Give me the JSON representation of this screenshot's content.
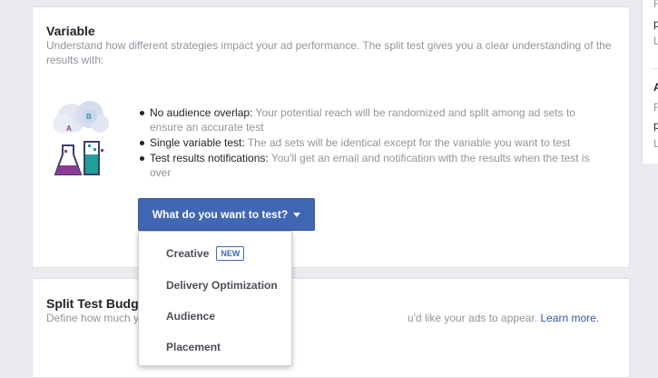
{
  "variable_card": {
    "title": "Variable",
    "description": "Understand how different strategies impact your ad performance. The split test gives you a clear understanding of the results with:",
    "bullets": [
      {
        "lead": "No audience overlap:",
        "text": " Your potential reach will be randomized and split among ad sets to ensure an accurate test"
      },
      {
        "lead": "Single variable test:",
        "text": " The ad sets will be identical except for the variable you want to test"
      },
      {
        "lead": "Test results notifications:",
        "text": " You'll get an email and notification with the results when the test is over"
      }
    ],
    "illustration_labels": {
      "a": "A",
      "b": "B"
    },
    "dropdown_label": "What do you want to test?"
  },
  "dropdown_menu": {
    "items": [
      {
        "label": "Creative",
        "badge": "NEW"
      },
      {
        "label": "Delivery Optimization"
      },
      {
        "label": "Audience"
      },
      {
        "label": "Placement"
      }
    ]
  },
  "budget_card": {
    "title": "Split Test Budg",
    "description_start": "Define how much y",
    "description_end": "u'd like your ads to appear.",
    "learn_more": "Learn more."
  },
  "right_panel": {
    "lines": [
      "F",
      "p",
      "L",
      "A",
      "F",
      "p",
      "L"
    ]
  },
  "colors": {
    "accent": "#4267b2",
    "muted_text": "#90949c",
    "page_bg": "#e9ebee"
  }
}
